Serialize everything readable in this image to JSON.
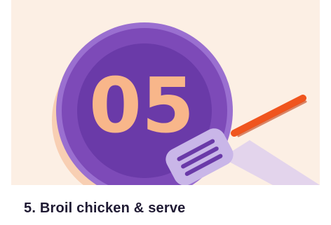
{
  "card": {
    "step_number": "05",
    "caption": "5. Broil chicken & serve",
    "illustration_icon": "spatula-icon"
  },
  "colors": {
    "background": "#fcefe4",
    "pan_outer": "#7d4ab8",
    "pan_inner": "#6a3aa8",
    "pan_shadow": "#f4b48a",
    "numeral": "#f8b68a",
    "spatula_handle": "#f0551e",
    "spatula_head": "#c9b6e8",
    "caption_text": "#1f1a33"
  }
}
